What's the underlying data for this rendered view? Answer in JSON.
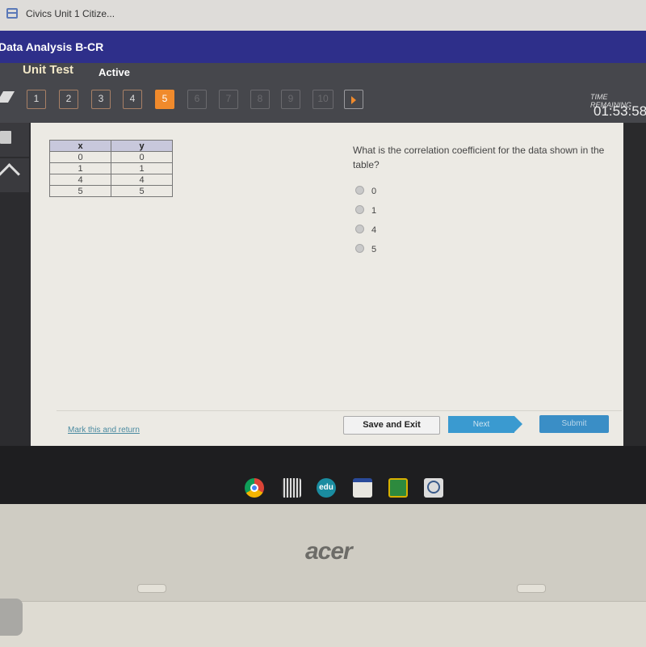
{
  "browser": {
    "tab_title": "Civics Unit 1 Citize..."
  },
  "header": {
    "course_title": "Data Analysis B-CR",
    "unit_title": "Unit Test",
    "status": "Active",
    "question_nav": [
      "1",
      "2",
      "3",
      "4",
      "5",
      "6",
      "7",
      "8",
      "9",
      "10"
    ],
    "current_question": "5",
    "time_label": "TIME REMAINING",
    "time_value": "01:53:58"
  },
  "table": {
    "headers": [
      "x",
      "y"
    ],
    "rows": [
      [
        "0",
        "0"
      ],
      [
        "1",
        "1"
      ],
      [
        "4",
        "4"
      ],
      [
        "5",
        "5"
      ]
    ]
  },
  "question": {
    "text": "What is the correlation coefficient for the data shown in the table?",
    "choices": [
      "0",
      "1",
      "4",
      "5"
    ]
  },
  "footer": {
    "mark_link": "Mark this and return",
    "save_exit": "Save and Exit",
    "next": "Next",
    "submit": "Submit"
  },
  "shelf": {
    "apps": [
      "chrome-icon",
      "qr-code-icon",
      "edu-icon",
      "app-icon",
      "google-classroom-icon",
      "search-lens-icon"
    ]
  },
  "laptop": {
    "brand": "acer"
  }
}
